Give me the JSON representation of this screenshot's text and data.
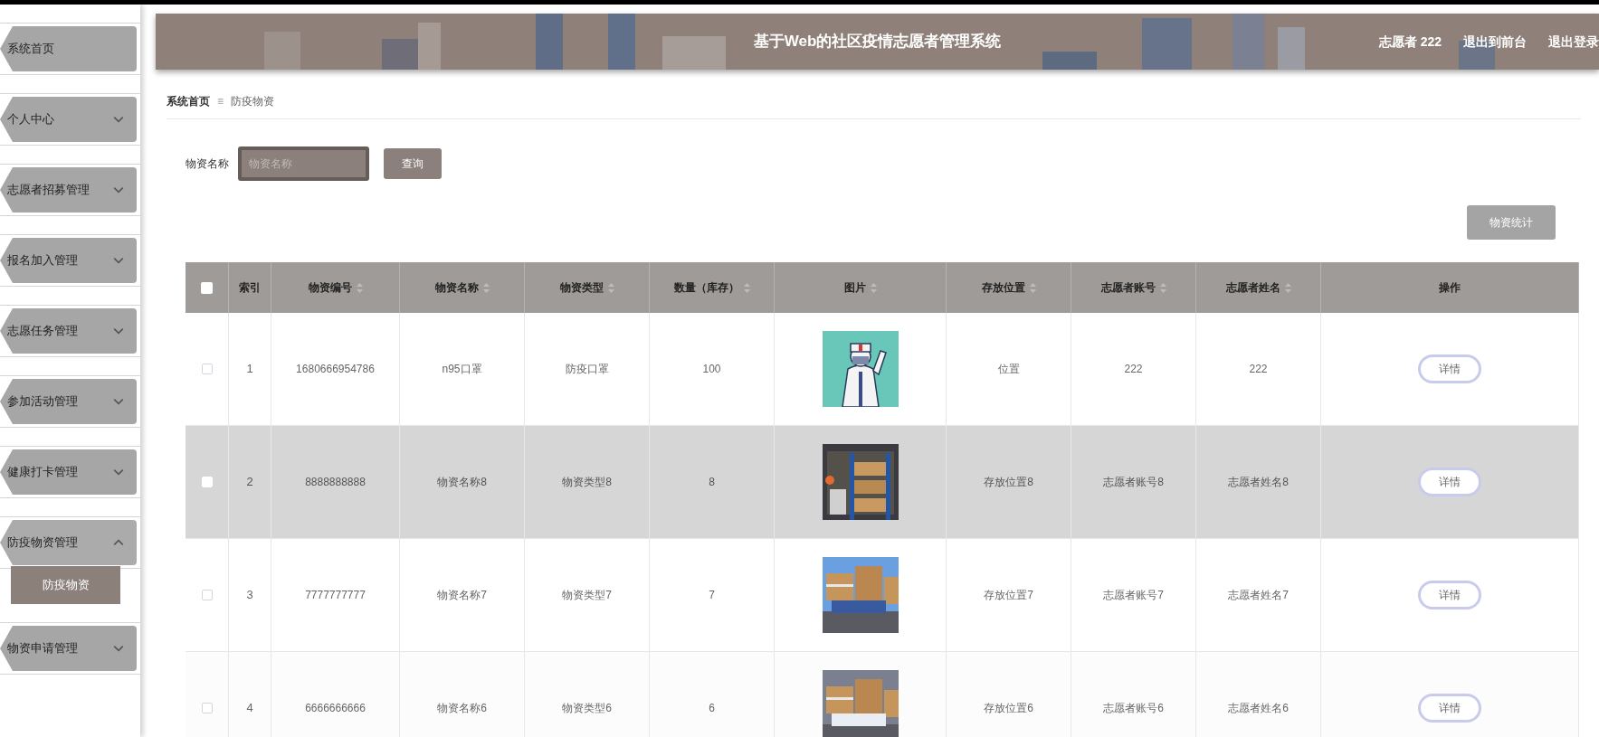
{
  "sidebar": {
    "items": [
      {
        "label": "系统首页",
        "kind": "link"
      },
      {
        "label": "个人中心",
        "kind": "menu",
        "expanded": false
      },
      {
        "label": "志愿者招募管理",
        "kind": "menu",
        "expanded": false
      },
      {
        "label": "报名加入管理",
        "kind": "menu",
        "expanded": false
      },
      {
        "label": "志愿任务管理",
        "kind": "menu",
        "expanded": false
      },
      {
        "label": "参加活动管理",
        "kind": "menu",
        "expanded": false
      },
      {
        "label": "健康打卡管理",
        "kind": "menu",
        "expanded": false
      },
      {
        "label": "防疫物资管理",
        "kind": "menu",
        "expanded": true,
        "children": [
          {
            "label": "防疫物资",
            "selected": true
          }
        ]
      },
      {
        "label": "物资申请管理",
        "kind": "menu",
        "expanded": false
      }
    ]
  },
  "header": {
    "title": "基于Web的社区疫情志愿者管理系统",
    "user": "志愿者 222",
    "links": [
      "退出到前台",
      "退出登录"
    ]
  },
  "breadcrumb": {
    "items": [
      "系统首页",
      "防疫物资"
    ],
    "separator": "≡"
  },
  "search": {
    "label": "物资名称",
    "placeholder": "物资名称",
    "button": "查询"
  },
  "stats_button": "物资统计",
  "table": {
    "all_checked": false,
    "columns": [
      {
        "label": "索引",
        "sortable": false
      },
      {
        "label": "物资编号",
        "sortable": true
      },
      {
        "label": "物资名称",
        "sortable": true
      },
      {
        "label": "物资类型",
        "sortable": true
      },
      {
        "label": "数量（库存）",
        "sortable": true
      },
      {
        "label": "图片",
        "sortable": true
      },
      {
        "label": "存放位置",
        "sortable": true
      },
      {
        "label": "志愿者账号",
        "sortable": true
      },
      {
        "label": "志愿者姓名",
        "sortable": true
      },
      {
        "label": "操作",
        "sortable": false
      }
    ],
    "rows": [
      {
        "checked": false,
        "highlighted": false,
        "cells": [
          "1",
          "1680666954786",
          "n95口罩",
          "防疫口罩",
          "100"
        ],
        "picture": {
          "kind": "picture"
        },
        "cells_after": [
          "位置",
          "222",
          "222"
        ],
        "action": "详情"
      },
      {
        "checked": false,
        "highlighted": true,
        "cells": [
          "2",
          "8888888888",
          "物资名称8",
          "物资类型8",
          "8"
        ],
        "picture": {
          "kind": "picture"
        },
        "cells_after": [
          "存放位置8",
          "志愿者账号8",
          "志愿者姓名8"
        ],
        "action": "详情"
      },
      {
        "checked": false,
        "highlighted": false,
        "cells": [
          "3",
          "7777777777",
          "物资名称7",
          "物资类型7",
          "7"
        ],
        "picture": {
          "kind": "picture"
        },
        "cells_after": [
          "存放位置7",
          "志愿者账号7",
          "志愿者姓名7"
        ],
        "action": "详情"
      },
      {
        "checked": false,
        "highlighted": false,
        "cells": [
          "4",
          "6666666666",
          "物资名称6",
          "物资类型6",
          "6"
        ],
        "picture": {
          "kind": "picture"
        },
        "cells_after": [
          "存放位置6",
          "志愿者账号6",
          "志愿者姓名6"
        ],
        "action": "详情"
      }
    ]
  }
}
